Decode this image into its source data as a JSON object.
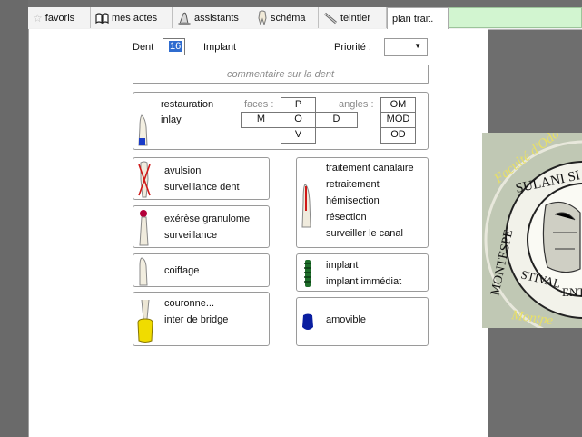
{
  "tabs": [
    {
      "label": "favoris",
      "icon": "star-icon"
    },
    {
      "label": "mes actes",
      "icon": "book-icon"
    },
    {
      "label": "assistants",
      "icon": "wizard-icon"
    },
    {
      "label": "schéma",
      "icon": "tooth-icon"
    },
    {
      "label": "teintier",
      "icon": "shade-guide-icon"
    },
    {
      "label": "plan trait.",
      "active": true
    }
  ],
  "header": {
    "dent_label": "Dent",
    "dent_value": "16",
    "implant_label": "Implant",
    "priorite_label": "Priorité :",
    "priorite_value": ""
  },
  "comment_placeholder": "commentaire sur la dent",
  "restoration": {
    "label_restauration": "restauration",
    "label_inlay": "inlay",
    "faces_label": "faces :",
    "angles_label": "angles :",
    "faces_top": "P",
    "faces_mid": [
      "M",
      "O",
      "D"
    ],
    "faces_bottom": "V",
    "angles": [
      "OM",
      "MOD",
      "OD"
    ]
  },
  "cards_left": [
    {
      "name": "avulsion",
      "lines": [
        "avulsion",
        "surveillance dent"
      ]
    },
    {
      "name": "exerese",
      "lines": [
        "exérèse granulome",
        "surveillance"
      ]
    },
    {
      "name": "coiffage",
      "lines": [
        "coiffage"
      ]
    },
    {
      "name": "couronne",
      "lines": [
        "couronne...",
        "inter de bridge"
      ]
    }
  ],
  "cards_right": [
    {
      "name": "endo",
      "lines": [
        "traitement canalaire",
        "retraitement",
        "hémisection",
        "résection",
        "surveiller le canal"
      ]
    },
    {
      "name": "implant",
      "lines": [
        "implant",
        "implant immédiat"
      ]
    },
    {
      "name": "amovible",
      "lines": [
        "amovible"
      ]
    }
  ],
  "seal": {
    "text_top": "Faculté d'Odo",
    "text_ring1": "SULANI SI",
    "text_ring2": "MONTESPE",
    "text_ring3": "STIVAL",
    "text_ring4": "ENTAL",
    "text_bottom": "Montpe"
  },
  "colors": {
    "tab_fill": "#d2f5d0",
    "crown_yellow": "#f0dc00",
    "inlay_blue": "#1a3cc8",
    "implant_green": "#1e6e2a",
    "denture_blue": "#0a1ea0",
    "avulsion_red": "#d01818"
  }
}
